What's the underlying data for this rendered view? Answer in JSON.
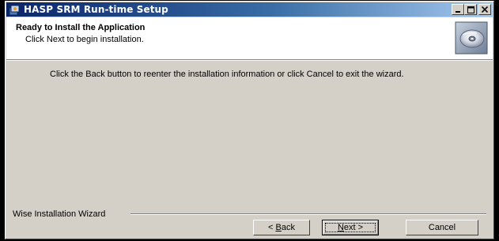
{
  "window": {
    "title": "HASP SRM Run-time Setup"
  },
  "header": {
    "title": "Ready to Install the Application",
    "subtitle": "Click Next to begin installation."
  },
  "body": {
    "message": "Click the Back button to reenter the installation information or click Cancel to exit the wizard."
  },
  "footer": {
    "brand": "Wise Installation Wizard",
    "back_prefix": "< ",
    "back_accel": "B",
    "back_rest": "ack",
    "next_accel": "N",
    "next_rest": "ext >",
    "cancel_label": "Cancel"
  }
}
